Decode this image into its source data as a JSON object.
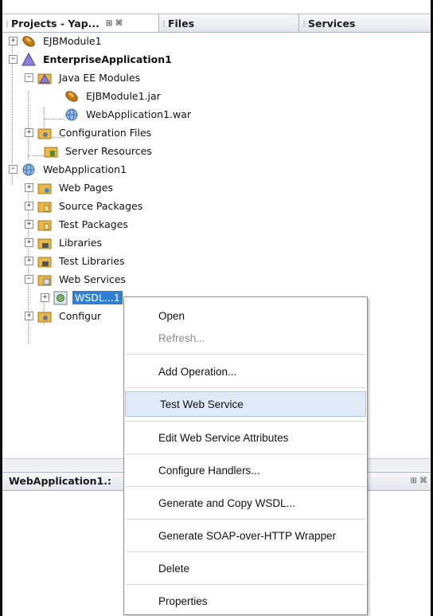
{
  "tabs": [
    {
      "label": "Projects - Yap...",
      "active": true,
      "controls": "⊞ ⌘"
    },
    {
      "label": "Files",
      "active": false
    },
    {
      "label": "Services",
      "active": false
    }
  ],
  "tree": {
    "ejb_module": "EJBModule1",
    "enterprise_app": "EnterpriseApplication1",
    "java_ee_modules": "Java EE Modules",
    "ejb_jar": "EJBModule1.jar",
    "web_war": "WebApplication1.war",
    "configuration_files": "Configuration Files",
    "server_resources": "Server Resources",
    "web_application": "WebApplication1",
    "web_pages": "Web Pages",
    "source_packages": "Source Packages",
    "test_packages": "Test Packages",
    "libraries": "Libraries",
    "test_libraries": "Test Libraries",
    "web_services": "Web Services",
    "wsdl_node": "WSDL...1",
    "configuration_partial": "Configur"
  },
  "lower_panel": {
    "title": "WebApplication1.:",
    "controls": "⊞ ⌘"
  },
  "context_menu": {
    "items": [
      {
        "label": "Open",
        "enabled": true
      },
      {
        "label": "Refresh...",
        "enabled": false
      },
      {
        "label": "Add Operation...",
        "enabled": true
      },
      {
        "label": "Test Web Service",
        "enabled": true,
        "highlighted": true
      },
      {
        "label": "Edit Web Service Attributes",
        "enabled": true
      },
      {
        "label": "Configure Handlers...",
        "enabled": true
      },
      {
        "label": "Generate and Copy WSDL...",
        "enabled": true
      },
      {
        "label": "Generate SOAP-over-HTTP Wrapper",
        "enabled": true
      },
      {
        "label": "Delete",
        "enabled": true
      },
      {
        "label": "Properties",
        "enabled": true
      }
    ]
  },
  "colors": {
    "selection": "#2f7fd3",
    "menu_hover": "#dfeaf8",
    "folder": "#e8b84a"
  },
  "icons": [
    "bean-icon",
    "enterprise-app-icon",
    "globe-icon",
    "folder-icon",
    "wsdl-icon"
  ]
}
